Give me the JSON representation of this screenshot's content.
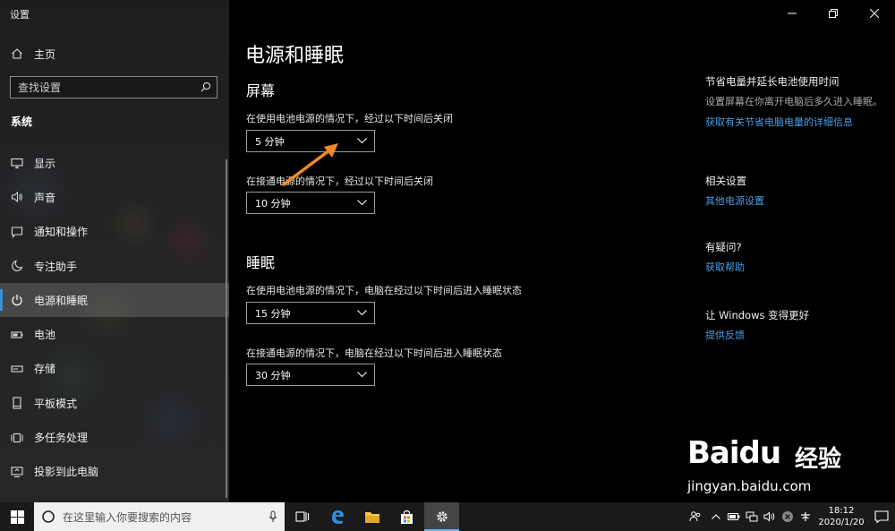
{
  "window": {
    "title": "设置"
  },
  "sidebar": {
    "home_label": "主页",
    "search_placeholder": "查找设置",
    "section_label": "系统",
    "items": [
      {
        "label": "显示",
        "icon": "monitor-icon"
      },
      {
        "label": "声音",
        "icon": "speaker-icon"
      },
      {
        "label": "通知和操作",
        "icon": "notification-icon"
      },
      {
        "label": "专注助手",
        "icon": "moon-icon"
      },
      {
        "label": "电源和睡眠",
        "icon": "power-icon",
        "active": true
      },
      {
        "label": "电池",
        "icon": "battery-icon"
      },
      {
        "label": "存储",
        "icon": "storage-icon"
      },
      {
        "label": "平板模式",
        "icon": "tablet-icon"
      },
      {
        "label": "多任务处理",
        "icon": "multitask-icon"
      },
      {
        "label": "投影到此电脑",
        "icon": "project-icon"
      }
    ]
  },
  "main": {
    "title": "电源和睡眠",
    "screen": {
      "heading": "屏幕",
      "battery_label": "在使用电池电源的情况下，经过以下时间后关闭",
      "battery_value": "5 分钟",
      "plugged_label": "在接通电源的情况下，经过以下时间后关闭",
      "plugged_value": "10 分钟"
    },
    "sleep": {
      "heading": "睡眠",
      "battery_label": "在使用电池电源的情况下，电脑在经过以下时间后进入睡眠状态",
      "battery_value": "15 分钟",
      "plugged_label": "在接通电源的情况下，电脑在经过以下时间后进入睡眠状态",
      "plugged_value": "30 分钟"
    }
  },
  "related": {
    "save_power_heading": "节省电量并延长电池使用时间",
    "save_power_text": "设置屏幕在你离开电脑后多久进入睡眠。",
    "save_power_link": "获取有关节省电脑电量的详细信息",
    "related_heading": "相关设置",
    "related_link": "其他电源设置",
    "question_heading": "有疑问?",
    "question_link": "获取帮助",
    "improve_heading": "让 Windows 变得更好",
    "improve_link": "提供反馈"
  },
  "watermark": {
    "brand": "Baidu",
    "brand_cn": "经验",
    "url": "jingyan.baidu.com"
  },
  "taskbar": {
    "search_placeholder": "在这里输入你要搜索的内容",
    "time": "18:12",
    "date": "2020/1/20"
  },
  "colors": {
    "accent": "#3a8fd9",
    "link": "#4a9ee6",
    "arrow": "#f08a24"
  }
}
